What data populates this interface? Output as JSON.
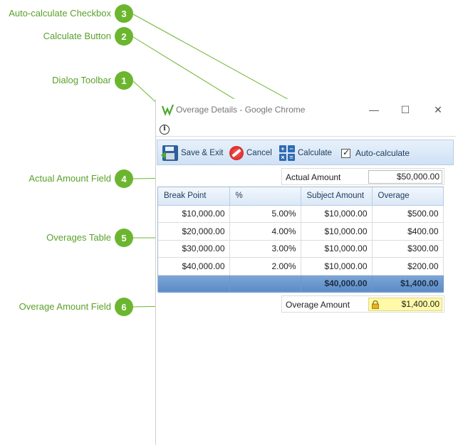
{
  "callouts": [
    {
      "num": "3",
      "label": "Auto-calculate Checkbox"
    },
    {
      "num": "2",
      "label": "Calculate Button"
    },
    {
      "num": "1",
      "label": "Dialog Toolbar"
    },
    {
      "num": "4",
      "label": "Actual Amount Field"
    },
    {
      "num": "5",
      "label": "Overages Table"
    },
    {
      "num": "6",
      "label": "Overage Amount Field"
    }
  ],
  "window": {
    "title": "Overage Details - Google Chrome",
    "controls": {
      "minimize": "—",
      "maximize": "☐",
      "close": "✕"
    },
    "info_icon": "info-icon",
    "app_icon": "app-logo-icon"
  },
  "toolbar": {
    "save_exit": "Save & Exit",
    "cancel": "Cancel",
    "calculate": "Calculate",
    "auto_calculate": "Auto-calculate",
    "auto_calculate_checked": true,
    "calc_symbols": [
      "+",
      "−",
      "×",
      "="
    ]
  },
  "actual_amount": {
    "label": "Actual Amount",
    "value": "$50,000.00"
  },
  "table": {
    "headers": [
      "Break Point",
      "%",
      "Subject Amount",
      "Overage"
    ],
    "rows": [
      [
        "$10,000.00",
        "5.00%",
        "$10,000.00",
        "$500.00"
      ],
      [
        "$20,000.00",
        "4.00%",
        "$10,000.00",
        "$400.00"
      ],
      [
        "$30,000.00",
        "3.00%",
        "$10,000.00",
        "$300.00"
      ],
      [
        "$40,000.00",
        "2.00%",
        "$10,000.00",
        "$200.00"
      ]
    ],
    "totals": [
      "",
      "",
      "$40,000.00",
      "$1,400.00"
    ]
  },
  "overage_amount": {
    "label": "Overage Amount",
    "value": "$1,400.00",
    "icon": "lock-icon"
  },
  "colors": {
    "callout": "#6cb62f",
    "toolbar": "#cfe1f5",
    "total_row": "#6f98cb",
    "readonly_field": "#fff9a8"
  }
}
